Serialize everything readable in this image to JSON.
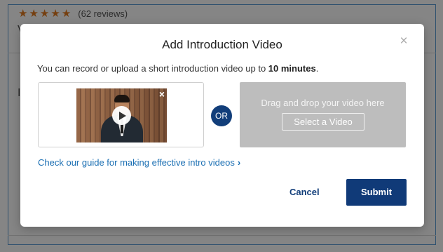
{
  "background": {
    "stars": [
      "★",
      "★",
      "★",
      "★",
      "★"
    ],
    "reviews_text": "(62 reviews)",
    "partial_char_1": "V",
    "partial_char_2": "I"
  },
  "modal": {
    "title": "Add Introduction Video",
    "close_glyph": "×",
    "description_prefix": "You can record or upload a short introduction video up to ",
    "description_bold": "10 minutes",
    "description_suffix": ".",
    "video_thumbnail": {
      "close_glyph": "×"
    },
    "or_label": "OR",
    "drop_zone": {
      "text": "Drag and drop your video here",
      "button_label": "Select a Video"
    },
    "guide_link": {
      "text": "Check our guide for making effective intro videos",
      "chevron": "›"
    },
    "cancel_label": "Cancel",
    "submit_label": "Submit"
  },
  "colors": {
    "brand_primary": "#103a78",
    "link": "#1b6fb3",
    "star": "#e07a1f",
    "dropzone_bg": "#bdbdbd"
  }
}
